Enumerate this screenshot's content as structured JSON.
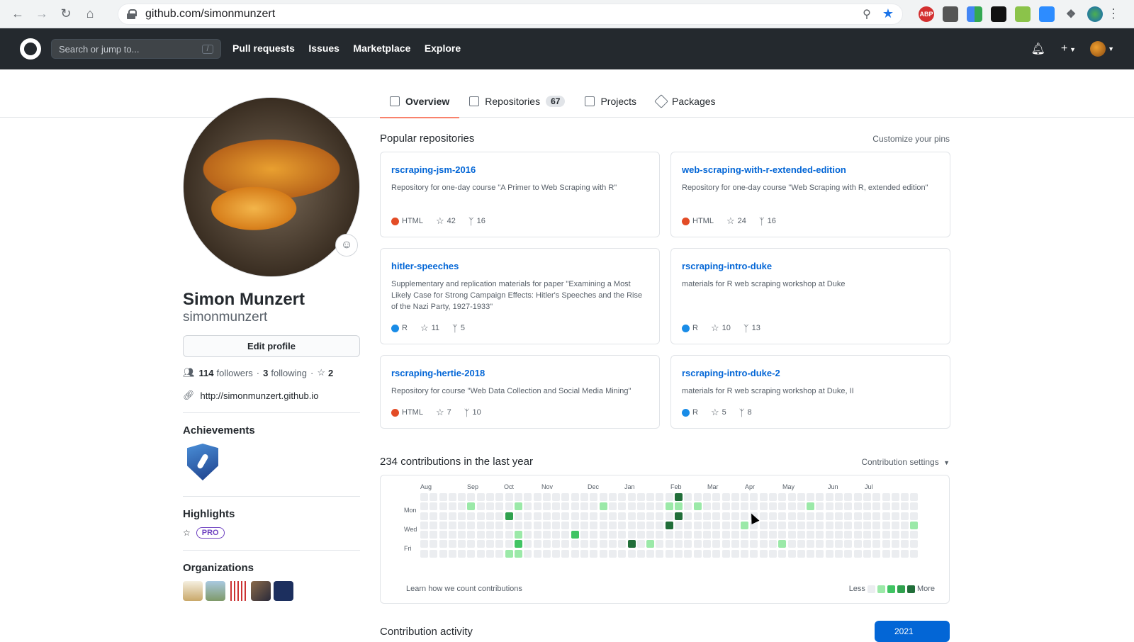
{
  "browser": {
    "url": "github.com/simonmunzert",
    "extensions": [
      "ABP",
      "",
      "",
      "",
      "",
      "",
      ""
    ]
  },
  "header": {
    "search_placeholder": "Search or jump to...",
    "search_shortcut": "/",
    "nav": [
      "Pull requests",
      "Issues",
      "Marketplace",
      "Explore"
    ]
  },
  "tabs": [
    {
      "label": "Overview",
      "count": ""
    },
    {
      "label": "Repositories",
      "count": "67"
    },
    {
      "label": "Projects",
      "count": ""
    },
    {
      "label": "Packages",
      "count": ""
    }
  ],
  "profile": {
    "name": "Simon Munzert",
    "login": "simonmunzert",
    "edit_label": "Edit profile",
    "followers": "114",
    "followers_label": "followers",
    "following": "3",
    "following_label": "following",
    "stars": "2",
    "website": "http://simonmunzert.github.io",
    "achievements_title": "Achievements",
    "highlights_title": "Highlights",
    "pro_label": "PRO",
    "orgs_title": "Organizations"
  },
  "popular": {
    "title": "Popular repositories",
    "customize": "Customize your pins",
    "repos": [
      {
        "name": "rscraping-jsm-2016",
        "desc": "Repository for one-day course \"A Primer to Web Scraping with R\"",
        "lang": "HTML",
        "lang_color": "#e34c26",
        "stars": "42",
        "forks": "16"
      },
      {
        "name": "web-scraping-with-r-extended-edition",
        "desc": "Repository for one-day course \"Web Scraping with R, extended edition\"",
        "lang": "HTML",
        "lang_color": "#e34c26",
        "stars": "24",
        "forks": "16"
      },
      {
        "name": "hitler-speeches",
        "desc": "Supplementary and replication materials for paper \"Examining a Most Likely Case for Strong Campaign Effects: Hitler's Speeches and the Rise of the Nazi Party, 1927-1933\"",
        "lang": "R",
        "lang_color": "#198ce7",
        "stars": "11",
        "forks": "5"
      },
      {
        "name": "rscraping-intro-duke",
        "desc": "materials for R web scraping workshop at Duke",
        "lang": "R",
        "lang_color": "#198ce7",
        "stars": "10",
        "forks": "13"
      },
      {
        "name": "rscraping-hertie-2018",
        "desc": "Repository for course \"Web Data Collection and Social Media Mining\"",
        "lang": "HTML",
        "lang_color": "#e34c26",
        "stars": "7",
        "forks": "10"
      },
      {
        "name": "rscraping-intro-duke-2",
        "desc": "materials for R web scraping workshop at Duke, II",
        "lang": "R",
        "lang_color": "#198ce7",
        "stars": "5",
        "forks": "8"
      }
    ]
  },
  "contributions": {
    "title": "234 contributions in the last year",
    "settings": "Contribution settings",
    "months": [
      "Aug",
      "Sep",
      "Oct",
      "Nov",
      "Dec",
      "Jan",
      "Feb",
      "Mar",
      "Apr",
      "May",
      "Jun",
      "Jul"
    ],
    "weekdays": [
      "Mon",
      "Wed",
      "Fri"
    ],
    "learn": "Learn how we count contributions",
    "less": "Less",
    "more": "More"
  },
  "activity": {
    "title": "Contribution activity",
    "year": "2021"
  }
}
